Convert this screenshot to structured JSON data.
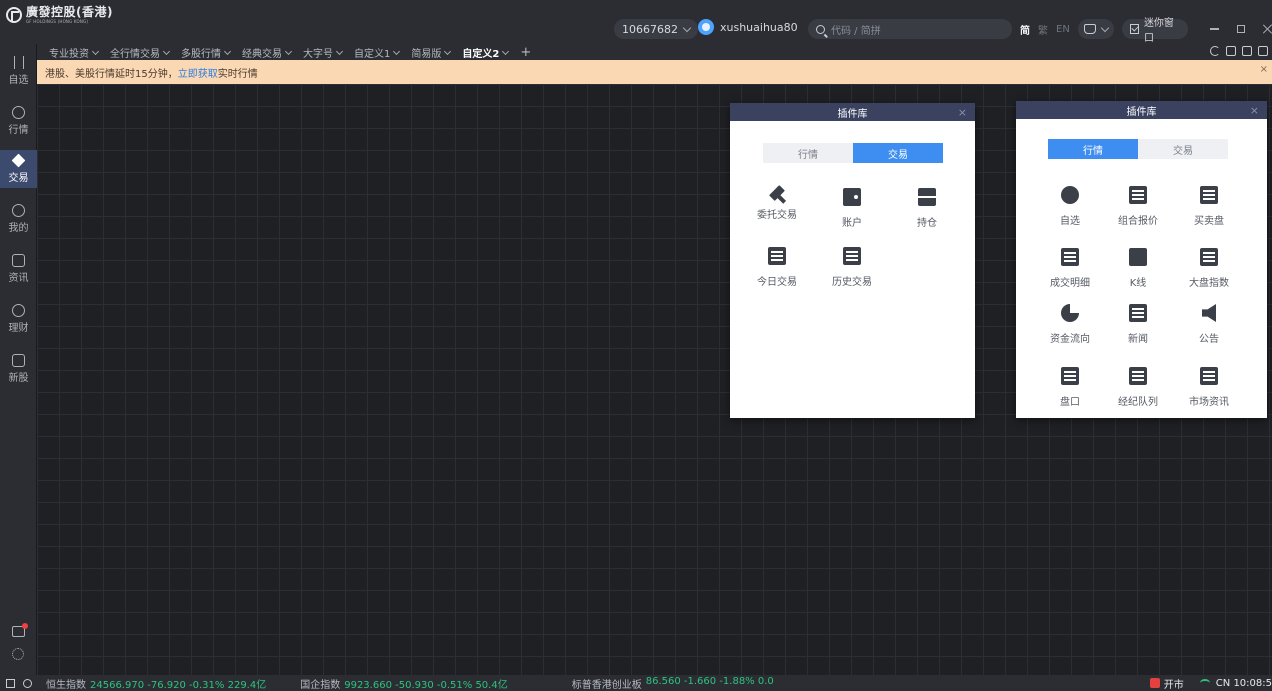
{
  "app": {
    "logo_cn": "廣發控股(香港)",
    "logo_en": "GF HOLDINGS (HONG KONG)",
    "account": "10667682",
    "username": "xushuaihua80",
    "search_placeholder": "代码 / 简拼",
    "lang_simplified": "简",
    "lang_traditional": "繁",
    "lang_en": "EN",
    "mini_window": "迷你窗口"
  },
  "sidebar": {
    "items": [
      {
        "label": "自选"
      },
      {
        "label": "行情"
      },
      {
        "label": "交易"
      },
      {
        "label": "我的"
      },
      {
        "label": "资讯"
      },
      {
        "label": "理财"
      },
      {
        "label": "新股"
      }
    ]
  },
  "tabs": [
    {
      "label": "专业投资"
    },
    {
      "label": "全行情交易"
    },
    {
      "label": "多股行情"
    },
    {
      "label": "经典交易"
    },
    {
      "label": "大字号"
    },
    {
      "label": "自定义1"
    },
    {
      "label": "简易版"
    },
    {
      "label": "自定义2"
    }
  ],
  "tab_add": "+",
  "notice": {
    "prefix": "港股、美股行情延时15分钟，",
    "link": "立即获取",
    "suffix": "实时行情",
    "close": "×"
  },
  "panel_left": {
    "title": "插件库",
    "close": "×",
    "seg_a": "行情",
    "seg_b": "交易",
    "items": [
      {
        "label": "委托交易",
        "icon": "hammer-icon"
      },
      {
        "label": "账户",
        "icon": "wallet-icon"
      },
      {
        "label": "持仓",
        "icon": "briefcase-icon"
      },
      {
        "label": "今日交易",
        "icon": "doc-check-icon"
      },
      {
        "label": "历史交易",
        "icon": "doc-clock-icon"
      }
    ]
  },
  "panel_right": {
    "title": "插件库",
    "close": "×",
    "seg_a": "行情",
    "seg_b": "交易",
    "items": [
      {
        "label": "自选",
        "icon": "heart-icon"
      },
      {
        "label": "组合报价",
        "icon": "chart-doc-icon"
      },
      {
        "label": "买卖盘",
        "icon": "order-book-icon"
      },
      {
        "label": "成交明细",
        "icon": "trade-detail-icon"
      },
      {
        "label": "K线",
        "icon": "kline-icon"
      },
      {
        "label": "大盘指数",
        "icon": "bar-chart-icon"
      },
      {
        "label": "资金流向",
        "icon": "pie-icon"
      },
      {
        "label": "新闻",
        "icon": "news-icon"
      },
      {
        "label": "公告",
        "icon": "speaker-icon"
      },
      {
        "label": "盘口",
        "icon": "list-icon"
      },
      {
        "label": "经纪队列",
        "icon": "broker-queue-icon"
      },
      {
        "label": "市场资讯",
        "icon": "market-info-icon"
      }
    ]
  },
  "status": {
    "idx1_name": "恒生指数",
    "idx1_val": "24566.970 -76.920 -0.31% 229.4亿",
    "idx2_name": "国企指数",
    "idx2_val": "9923.660 -50.930 -0.51% 50.4亿",
    "idx3_name": "标普香港创业板",
    "idx3_val": "86.560 -1.660 -1.88% 0.0",
    "market_state": "开市",
    "clock": "CN 10:08:5"
  },
  "colors": {
    "accent": "#3d8ef0",
    "up_down_green": "#2ec27e",
    "notice_bg": "#fbd8b4"
  }
}
